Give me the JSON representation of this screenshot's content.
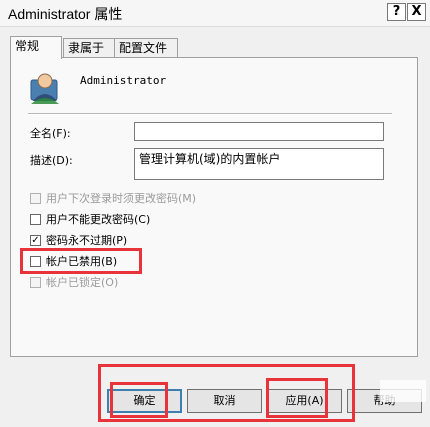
{
  "window": {
    "title": "Administrator 属性",
    "help_glyph": "?",
    "close_glyph": "X"
  },
  "tabs": [
    {
      "label": "常规",
      "active": true
    },
    {
      "label": "隶属于",
      "active": false
    },
    {
      "label": "配置文件",
      "active": false
    }
  ],
  "user": {
    "icon": "user-icon",
    "name": "Administrator"
  },
  "form": {
    "fullname_label": "全名(F):",
    "fullname_value": "",
    "description_label": "描述(D):",
    "description_value": "管理计算机(域)的内置帐户"
  },
  "options": [
    {
      "label": "用户下次登录时须更改密码(M)",
      "checked": false,
      "enabled": false
    },
    {
      "label": "用户不能更改密码(C)",
      "checked": false,
      "enabled": true
    },
    {
      "label": "密码永不过期(P)",
      "checked": true,
      "enabled": true
    },
    {
      "label": "帐户已禁用(B)",
      "checked": false,
      "enabled": true
    },
    {
      "label": "帐户已锁定(O)",
      "checked": false,
      "enabled": false
    }
  ],
  "check_glyph": "✓",
  "buttons": {
    "ok": "确定",
    "cancel": "取消",
    "apply": "应用(A)",
    "help": "帮助"
  },
  "highlight_color": "#e8333a"
}
